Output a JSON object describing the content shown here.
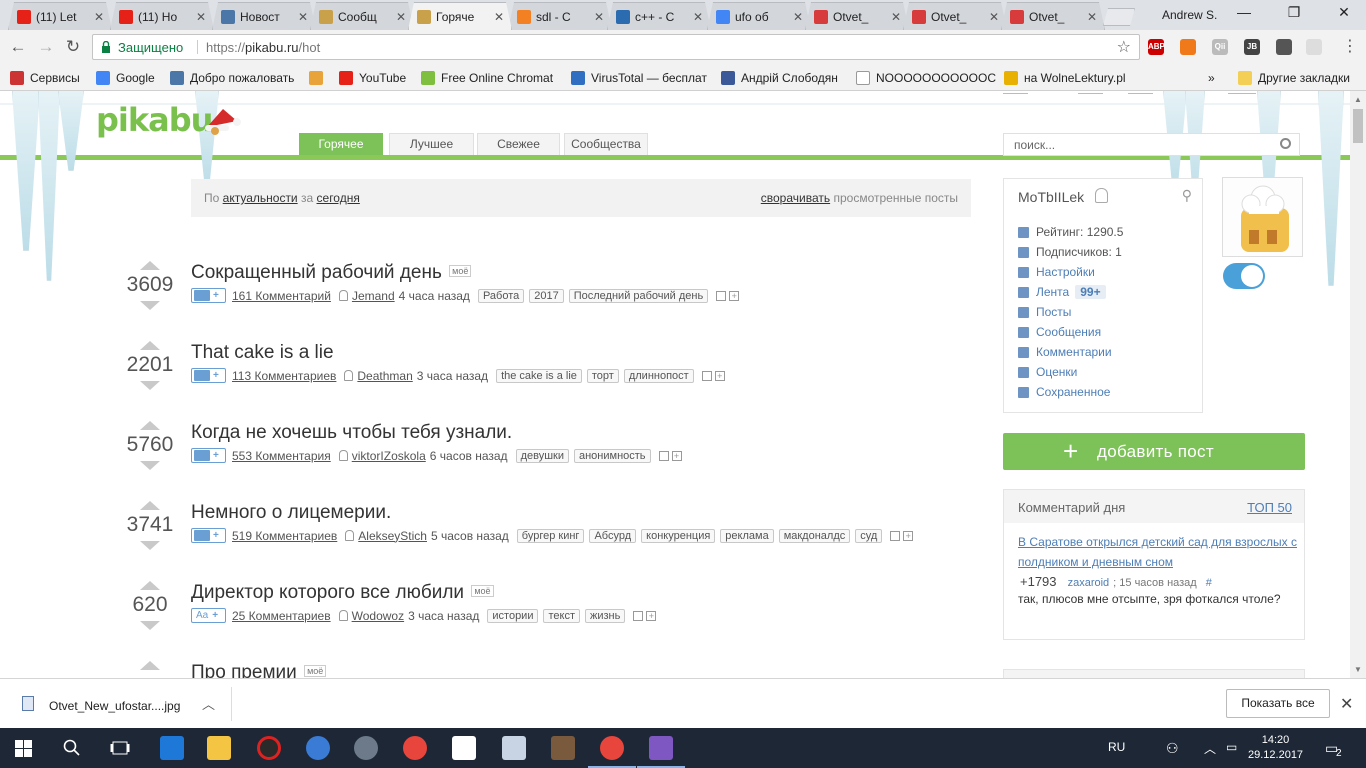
{
  "browser": {
    "tabs": [
      {
        "title": "(11) Let",
        "favicon": "youtube-icon",
        "color": "#e62117"
      },
      {
        "title": "(11) Ho",
        "favicon": "youtube-icon",
        "color": "#e62117"
      },
      {
        "title": "Новост",
        "favicon": "vk-icon",
        "color": "#4a76a8"
      },
      {
        "title": "Сообщ",
        "favicon": "pikabu-icon",
        "color": "#c9a14a"
      },
      {
        "title": "Горяче",
        "favicon": "pikabu-icon",
        "color": "#c9a14a"
      },
      {
        "title": "sdl - C",
        "favicon": "stackoverflow-icon",
        "color": "#f48024"
      },
      {
        "title": "c++ - C",
        "favicon": "cplusplus-icon",
        "color": "#2b6cb0"
      },
      {
        "title": "ufo об",
        "favicon": "google-icon",
        "color": "#4285f4"
      },
      {
        "title": "Otvet_",
        "favicon": "image-icon",
        "color": "#d83b3b"
      },
      {
        "title": "Otvet_",
        "favicon": "image-icon",
        "color": "#d83b3b"
      },
      {
        "title": "Otvet_",
        "favicon": "image-icon",
        "color": "#d83b3b"
      }
    ],
    "active_tab_index": 4,
    "user_name": "Andrew S.",
    "secure_label": "Защищено",
    "url_scheme": "https://",
    "url_host": "pikabu.ru",
    "url_path": "/hot",
    "extensions": [
      {
        "name": "adblock-icon",
        "label": "ABP",
        "badge": "5",
        "color": "#c00"
      },
      {
        "name": "fire-icon",
        "label": "",
        "color": "#f07a1a"
      },
      {
        "name": "qii-icon",
        "label": "Qii",
        "color": "#bbb"
      },
      {
        "name": "jb-icon",
        "label": "JB",
        "color": "#444"
      },
      {
        "name": "ext-tile-icon",
        "label": "",
        "color": "#555"
      },
      {
        "name": "ext-square-icon",
        "label": "",
        "color": "#ddd"
      },
      {
        "name": "ghost-icon",
        "label": "",
        "badge": "2",
        "color": "#333"
      }
    ],
    "bookmarks": [
      {
        "label": "Сервисы",
        "icon": "apps-grid-icon",
        "color": "#c33"
      },
      {
        "label": "Google",
        "icon": "google-icon",
        "color": "#4285f4"
      },
      {
        "label": "Добро пожаловать",
        "icon": "vk-icon",
        "color": "#4a76a8"
      },
      {
        "label": "",
        "icon": "flower-icon",
        "color": "#e8a33a"
      },
      {
        "label": "YouTube",
        "icon": "youtube-icon",
        "color": "#e62117"
      },
      {
        "label": "Free Online Chromat",
        "icon": "pencil-icon",
        "color": "#7fbf3f"
      },
      {
        "label": "VirusTotal — бесплат",
        "icon": "virustotal-icon",
        "color": "#2f6ec0"
      },
      {
        "label": "Андрій Слободян",
        "icon": "facebook-icon",
        "color": "#3b5998"
      },
      {
        "label": "NOOOOOOOOOOOC",
        "icon": "page-icon",
        "color": "#ffffff"
      },
      {
        "label": "на WolneLektury.pl",
        "icon": "wolnelektury-icon",
        "color": "#e8b000"
      }
    ],
    "bookmarks_more": "»",
    "other_bookmarks": "Другие закладки"
  },
  "site": {
    "logo": "pikabu",
    "nav_tabs": [
      "Горячее",
      "Лучшее",
      "Свежее",
      "Сообщества"
    ],
    "active_nav": 0,
    "search_placeholder": "поиск...",
    "filter": {
      "prefix": "По",
      "sort": "актуальности",
      "mid": "за",
      "period": "сегодня",
      "collapse": "сворачивать",
      "collapse_suffix": "просмотренные посты"
    },
    "posts": [
      {
        "score": "3609",
        "title": "Сокращенный рабочий день",
        "mine": "моё",
        "type": "text-icon",
        "comments": "161 Комментарий",
        "author": "Jemand",
        "ago": "4 часа назад",
        "tags": [
          "Работа",
          "2017",
          "Последний рабочий день"
        ]
      },
      {
        "score": "2201",
        "title": "That cake is a lie",
        "mine": "",
        "type": "image-icon",
        "comments": "113 Комментариев",
        "author": "Deathman",
        "ago": "3 часа назад",
        "tags": [
          "the cake is a lie",
          "торт",
          "длиннопост"
        ]
      },
      {
        "score": "5760",
        "title": "Когда не хочешь чтобы тебя узнали.",
        "mine": "",
        "type": "image-icon",
        "comments": "553 Комментария",
        "author": "viktorIZoskola",
        "ago": "6 часов назад",
        "tags": [
          "девушки",
          "анонимность"
        ]
      },
      {
        "score": "3741",
        "title": "Немного о лицемерии.",
        "mine": "",
        "type": "text-icon",
        "comments": "519 Комментариев",
        "author": "AlekseyStich",
        "ago": "5 часов назад",
        "tags": [
          "бургер кинг",
          "Абсурд",
          "конкуренция",
          "реклама",
          "макдоналдс",
          "суд"
        ]
      },
      {
        "score": "620",
        "title": "Директор которого все любили",
        "mine": "моё",
        "type": "font-icon",
        "type_label": "Aa",
        "comments": "25 Комментариев",
        "author": "Wodowoz",
        "ago": "3 часа назад",
        "tags": [
          "истории",
          "текст",
          "жизнь"
        ]
      },
      {
        "score": "",
        "title": "Про премии",
        "mine": "моё",
        "type": "",
        "comments": "",
        "author": "",
        "ago": "",
        "tags": []
      }
    ],
    "user": {
      "name": "MoTbIILek",
      "rating_label": "Рейтинг: 1290.5",
      "subscribers_label": "Подписчиков: 1",
      "menu": [
        "Настройки",
        "Лента",
        "Посты",
        "Сообщения",
        "Комментарии",
        "Оценки",
        "Сохраненное"
      ],
      "feed_badge": "99+"
    },
    "add_post": "добавить пост",
    "comment_of_day": {
      "header": "Комментарий дня",
      "top_link": "ТОП 50",
      "post_link": "В Саратове открылся детский сад для взрослых с полдником и дневным сном",
      "score": "+1793",
      "user": "zaxaroid",
      "ago": "15 часов назад",
      "hash": "#",
      "text": "так, плюсов мне отсыпте, зря фоткался чтоле?"
    },
    "accent_color": "#7dc159",
    "link_color": "#4d7eb6"
  },
  "downloads": {
    "file_name": "Otvet_New_ufostar....jpg",
    "show_all": "Показать все"
  },
  "taskbar": {
    "language": "RU",
    "time": "14:20",
    "date": "29.12.2017",
    "notifications": "2"
  }
}
